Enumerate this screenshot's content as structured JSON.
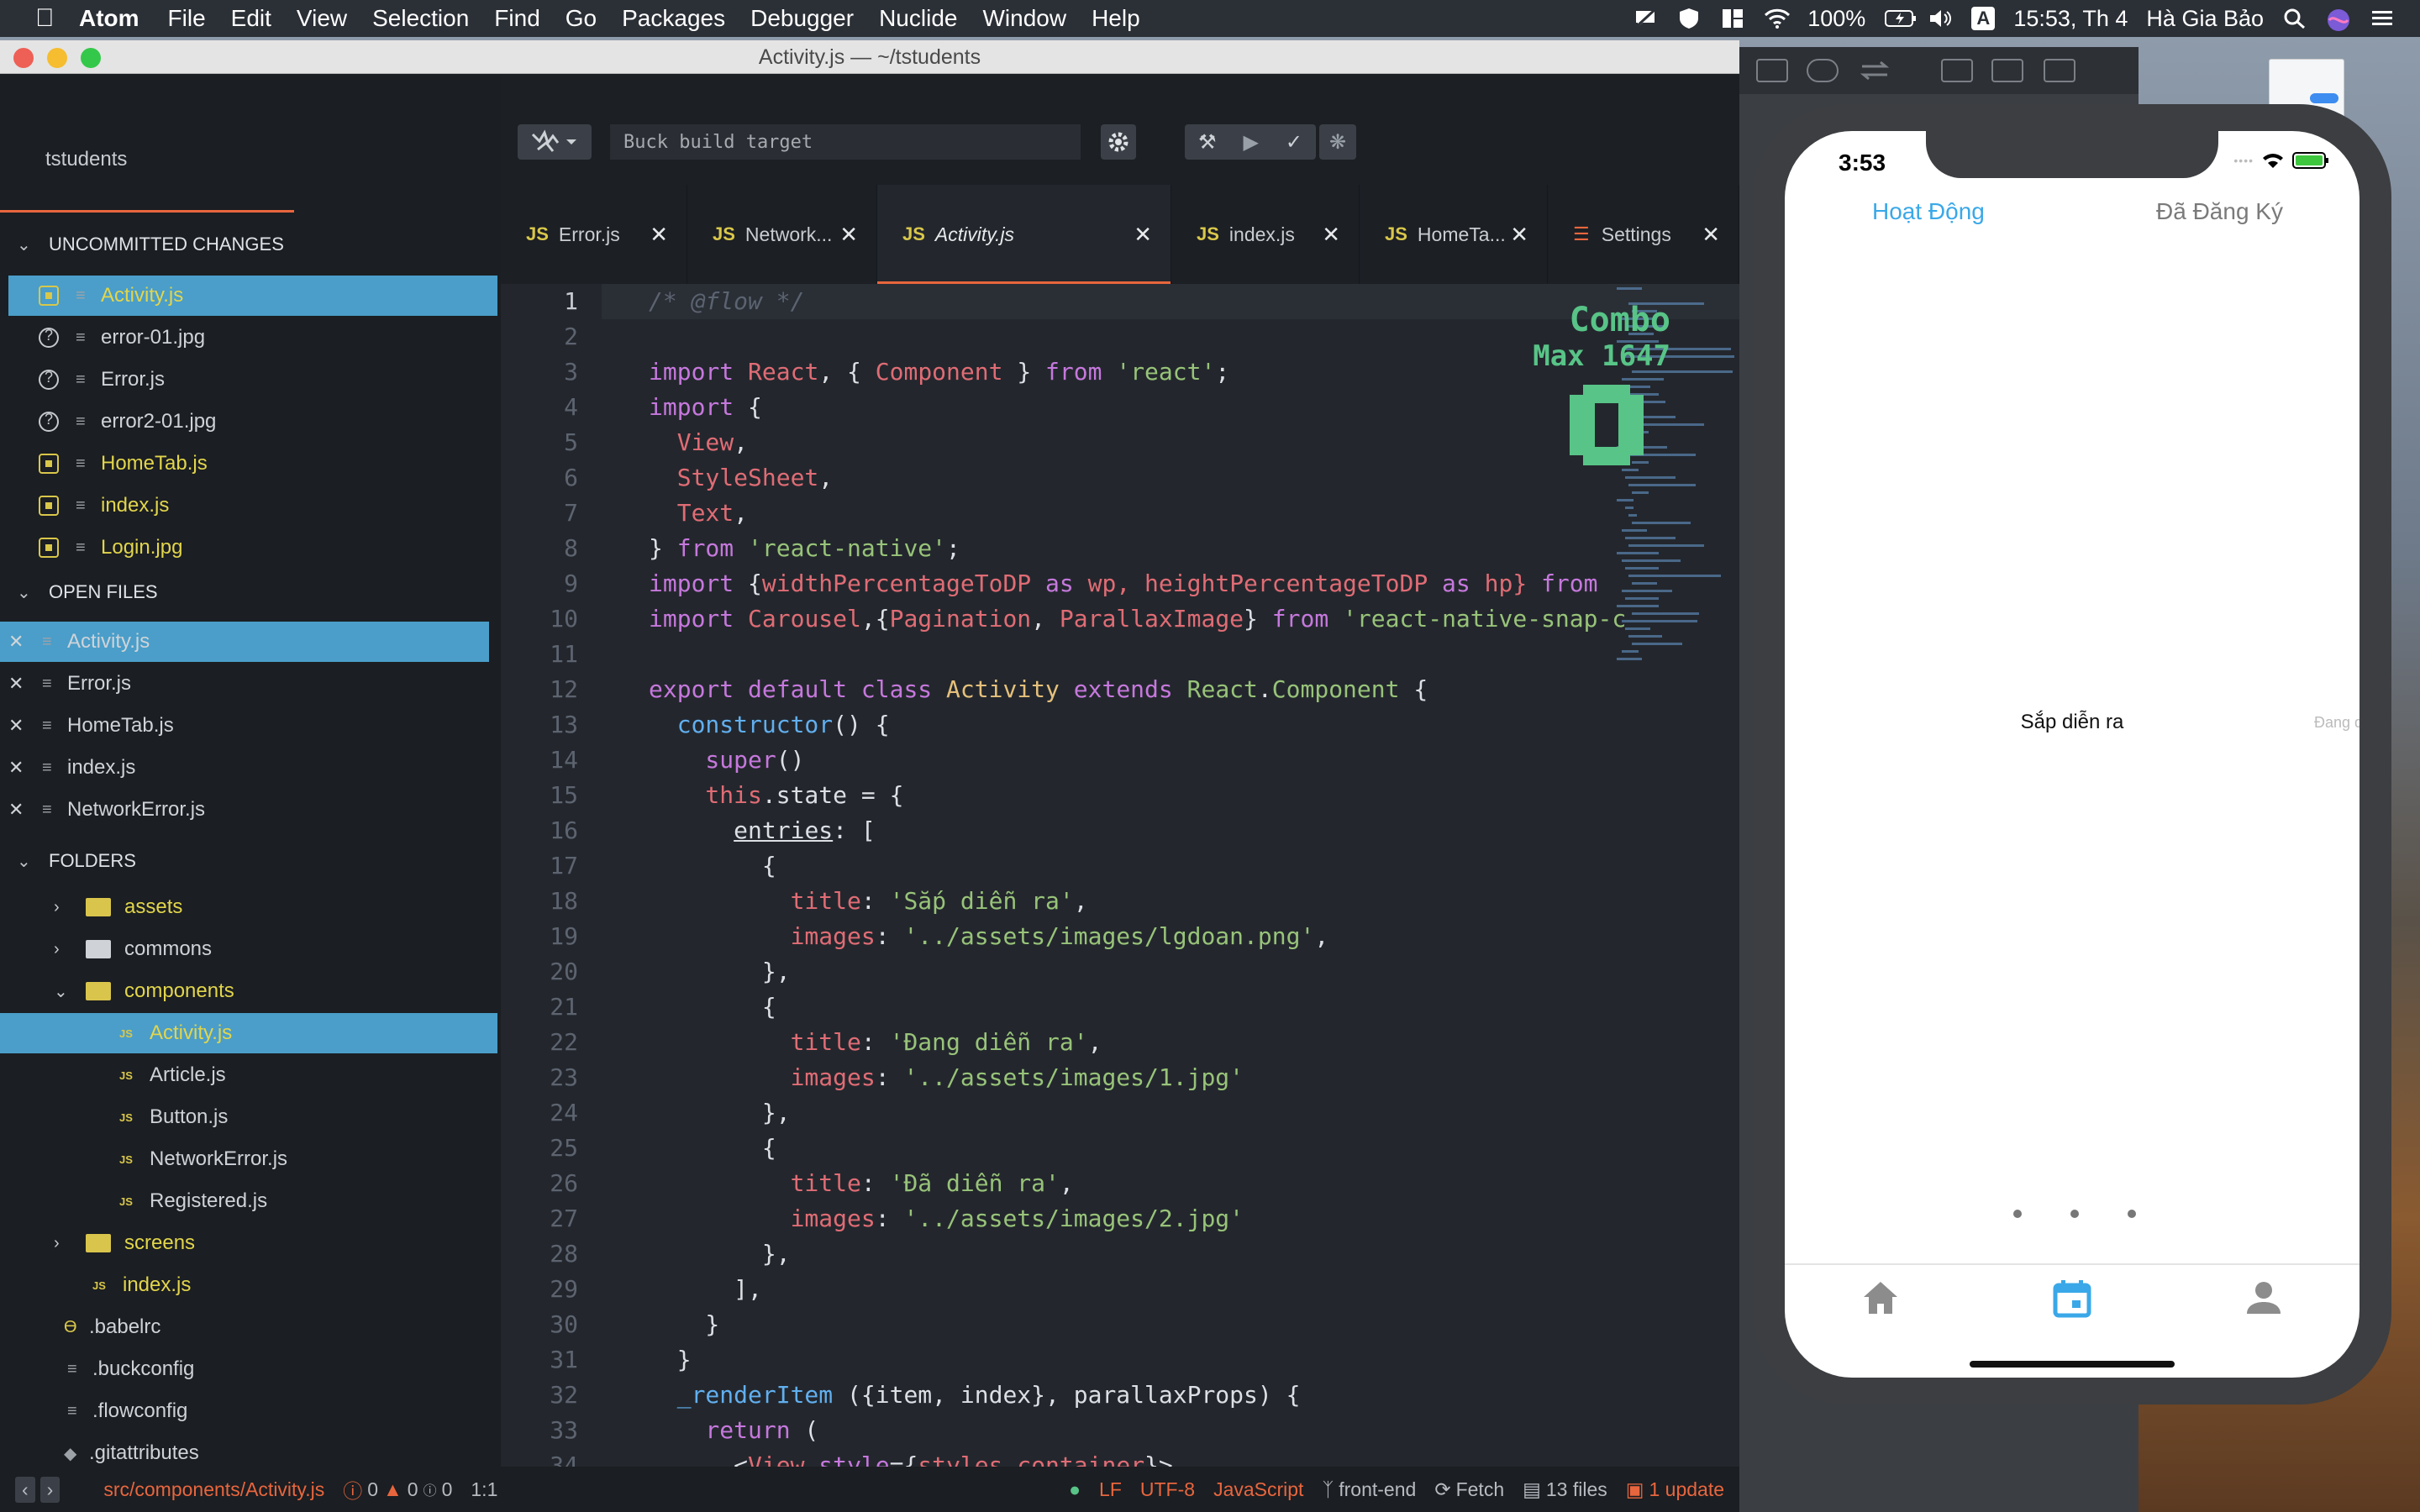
{
  "menubar": {
    "app": "Atom",
    "items": [
      "File",
      "Edit",
      "View",
      "Selection",
      "Find",
      "Go",
      "Packages",
      "Debugger",
      "Nuclide",
      "Window",
      "Help"
    ],
    "battery": "100%",
    "clock": "15:53, Th 4",
    "user": "Hà Gia Bảo",
    "input_source": "A"
  },
  "window": {
    "title": "Activity.js — ~/tstudents"
  },
  "tree": {
    "project": "tstudents",
    "uncommitted_title": "UNCOMMITTED CHANGES",
    "uncommitted": [
      "Activity.js",
      "error-01.jpg",
      "Error.js",
      "error2-01.jpg",
      "HomeTab.js",
      "index.js",
      "Login.jpg"
    ],
    "open_title": "OPEN FILES",
    "open": [
      "Activity.js",
      "Error.js",
      "HomeTab.js",
      "index.js",
      "NetworkError.js"
    ],
    "folders_title": "FOLDERS",
    "folders": [
      "assets",
      "commons",
      "components",
      "Activity.js",
      "Article.js",
      "Button.js",
      "NetworkError.js",
      "Registered.js",
      "screens",
      "index.js",
      ".babelrc",
      ".buckconfig",
      ".flowconfig",
      ".gitattributes"
    ]
  },
  "toolbar": {
    "buck_placeholder": "Buck build target"
  },
  "tabs": [
    "Error.js",
    "Network...",
    "Activity.js",
    "index.js",
    "HomeTa...",
    "Settings"
  ],
  "editor": {
    "line_numbers": [
      "1",
      "2",
      "3",
      "4",
      "5",
      "6",
      "7",
      "8",
      "9",
      "10",
      "11",
      "12",
      "13",
      "14",
      "15",
      "16",
      "17",
      "18",
      "19",
      "20",
      "21",
      "22",
      "23",
      "24",
      "25",
      "26",
      "27",
      "28",
      "29",
      "30",
      "31",
      "32",
      "33",
      "34"
    ],
    "combo": {
      "label": "Combo",
      "max": "Max 1647",
      "count": "0"
    },
    "code": {
      "l1": "/* @flow */",
      "l3_import": "import",
      "l3_react": " React",
      "l3_p1": ", { ",
      "l3_comp": "Component",
      "l3_p2": " } ",
      "l3_from": "from",
      "l3_str": " 'react'",
      "l3_end": ";",
      "l4_import": "import",
      "l4_rest": " {",
      "l5": "  View",
      "l5_end": ",",
      "l6": "  StyleSheet",
      "l6_end": ",",
      "l7": "  Text",
      "l7_end": ",",
      "l8_p": "} ",
      "l8_from": "from",
      "l8_str": " 'react-native'",
      "l8_end": ";",
      "l9_import": "import",
      "l9_b": " {",
      "l9_a": "widthPercentageToDP",
      "l9_as": " as",
      "l9_b2": " wp, ",
      "l9_c": "heightPercentageToDP",
      "l9_as2": " as",
      "l9_d": " hp} ",
      "l9_from": "from",
      "l10_import": "import",
      "l10_a": " Carousel",
      "l10_b": ",{",
      "l10_c": "Pagination",
      "l10_d": ", ",
      "l10_e": "ParallaxImage",
      "l10_f": "} ",
      "l10_from": "from",
      "l10_str": " 'react-native-snap-c",
      "l12_export": "export",
      "l12_default": " default",
      "l12_class": " class",
      "l12_name": " Activity",
      "l12_ext": " extends",
      "l12_react": " React",
      "l12_dot": ".",
      "l12_comp": "Component",
      "l12_brace": " {",
      "l13_fn": "  constructor",
      "l13_rest": "() {",
      "l14_fn": "    super",
      "l14_rest": "()",
      "l15_this": "    this",
      "l15_rest": ".state = {",
      "l16_pre": "      ",
      "l16_key": "entries",
      "l16_rest": ": [",
      "l17": "        {",
      "l18_key": "          title",
      "l18_p": ": ",
      "l18_str": "'Sắp diễn ra'",
      "l18_end": ",",
      "l19_key": "          images",
      "l19_p": ": ",
      "l19_str": "'../assets/images/lgdoan.png'",
      "l19_end": ",",
      "l20": "        },",
      "l21": "        {",
      "l22_key": "          title",
      "l22_p": ": ",
      "l22_str": "'Đang diễn ra'",
      "l22_end": ",",
      "l23_key": "          images",
      "l23_p": ": ",
      "l23_str": "'../assets/images/1.jpg'",
      "l24": "        },",
      "l25": "        {",
      "l26_key": "          title",
      "l26_p": ": ",
      "l26_str": "'Đã diễn ra'",
      "l26_end": ",",
      "l27_key": "          images",
      "l27_p": ": ",
      "l27_str": "'../assets/images/2.jpg'",
      "l28": "        },",
      "l29": "      ],",
      "l30": "    }",
      "l31": "  }",
      "l32_fn": "  _renderItem",
      "l32_rest": " ({item, index}, parallaxProps) {",
      "l33_ret": "    return",
      "l33_rest": " (",
      "l34_pre": "      <",
      "l34_tag": "View",
      "l34_attr": " style",
      "l34_eq": "={",
      "l34_val": "styles.container",
      "l34_end": "}>"
    }
  },
  "statusbar": {
    "path": "src/components/Activity.js",
    "errors": "0",
    "warnings": "0",
    "infos": "0",
    "cursor": "1:1",
    "eol": "LF",
    "encoding": "UTF-8",
    "grammar": "JavaScript",
    "branch": "front-end",
    "fetch": "Fetch",
    "files": "13 files",
    "update": "1 update"
  },
  "phone": {
    "time": "3:53",
    "tab_active": "Hoạt Động",
    "tab_other": "Đã Đăng Ký",
    "carousel_title": "Sắp diễn ra",
    "carousel_peek": "Đang d",
    "active_nav": "calendar"
  },
  "colors": {
    "accent": "#e8663e",
    "selection": "#4a9ec9",
    "modified": "#e2d54c",
    "phone_accent": "#3aa8e8"
  }
}
